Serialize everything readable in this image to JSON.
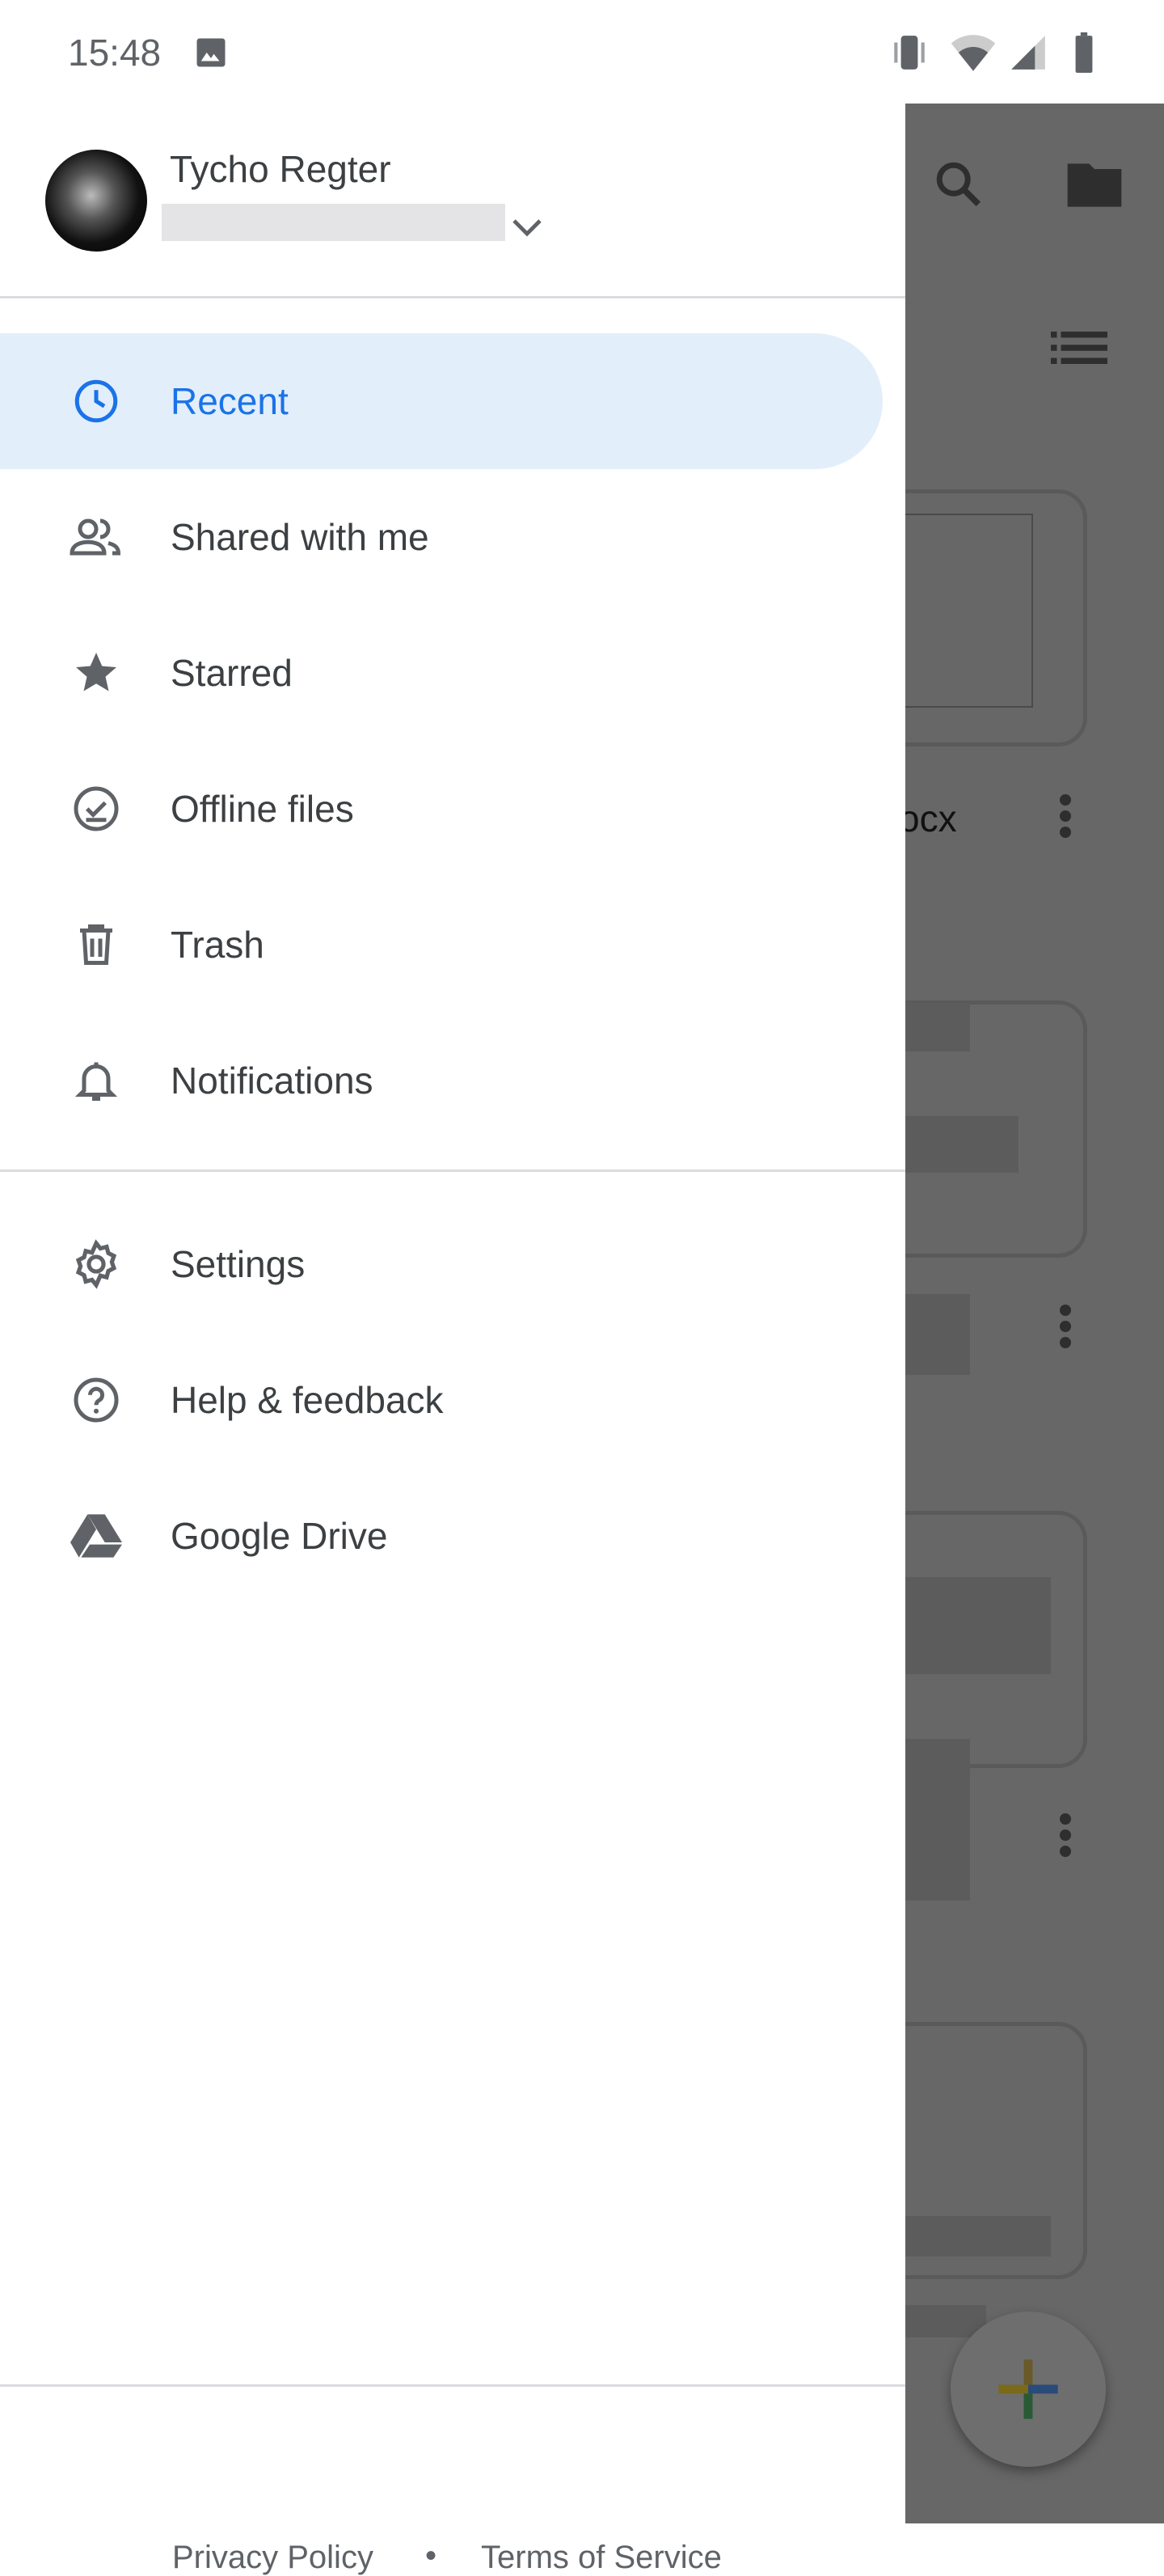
{
  "status_bar": {
    "time": "15:48",
    "icons": [
      "image-icon",
      "vibrate-icon",
      "wifi-icon",
      "signal-icon",
      "battery-icon"
    ]
  },
  "account": {
    "name": "Tycho Regter"
  },
  "nav": {
    "items": [
      {
        "label": "Recent",
        "icon": "clock-icon",
        "active": true
      },
      {
        "label": "Shared with me",
        "icon": "people-icon"
      },
      {
        "label": "Starred",
        "icon": "star-icon"
      },
      {
        "label": "Offline files",
        "icon": "offline-check-icon"
      },
      {
        "label": "Trash",
        "icon": "trash-icon"
      },
      {
        "label": "Notifications",
        "icon": "bell-icon"
      }
    ],
    "secondary": [
      {
        "label": "Settings",
        "icon": "gear-icon"
      },
      {
        "label": "Help & feedback",
        "icon": "help-icon"
      },
      {
        "label": "Google Drive",
        "icon": "drive-icon"
      }
    ]
  },
  "footer": {
    "privacy": "Privacy Policy",
    "separator": "•",
    "terms": "Terms of Service"
  },
  "background": {
    "file_suffix": "ocx"
  },
  "colors": {
    "accent": "#1a73e8",
    "active_bg": "#e3eefb",
    "scrim": "#676767"
  }
}
